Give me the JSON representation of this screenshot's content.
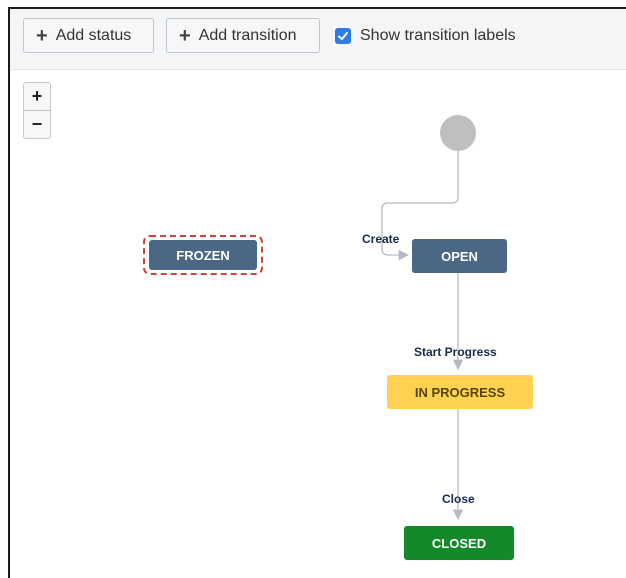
{
  "toolbar": {
    "add_status_label": "Add status",
    "add_transition_label": "Add transition",
    "show_labels_text": "Show transition labels",
    "show_labels_checked": true
  },
  "zoom": {
    "in_symbol": "+",
    "out_symbol": "−"
  },
  "statuses": {
    "frozen": "FROZEN",
    "open": "OPEN",
    "in_progress": "IN PROGRESS",
    "closed": "CLOSED"
  },
  "transitions": {
    "create": "Create",
    "start_progress": "Start Progress",
    "close": "Close"
  },
  "colors": {
    "todo": "#4a6785",
    "in_progress": "#ffd351",
    "done": "#14892c",
    "selection": "#d04437",
    "checkbox": "#2b7ce9"
  }
}
